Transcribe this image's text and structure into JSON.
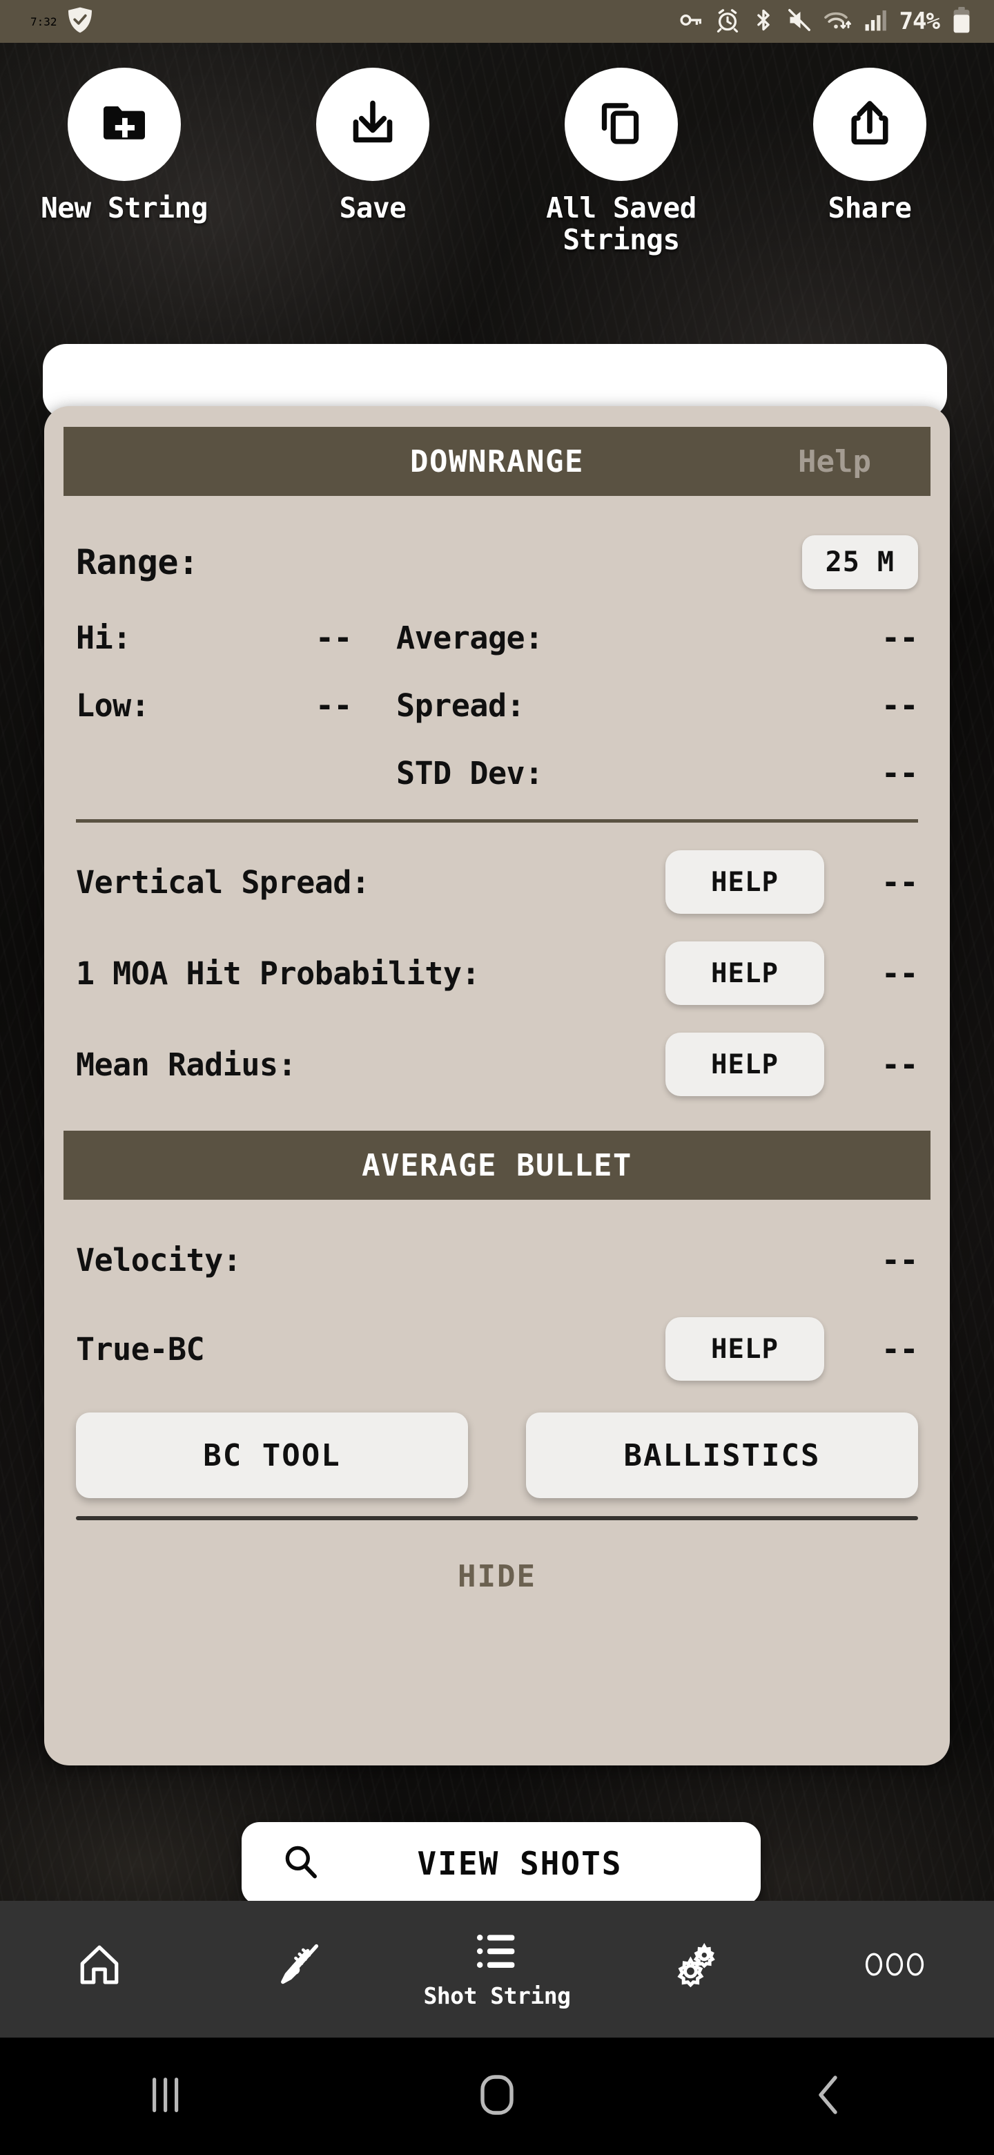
{
  "status_bar": {
    "time": "7:32",
    "shield_icon": "shield-check-icon",
    "icons": [
      "vpn-key-icon",
      "alarm-icon",
      "bluetooth-icon",
      "mute-icon",
      "wifi-icon",
      "cellular-signal-icon"
    ],
    "battery_percent": "74%",
    "background_color": "#5a5242"
  },
  "toolbar": {
    "items": [
      {
        "label": "New String",
        "icon": "folder-plus-icon"
      },
      {
        "label": "Save",
        "icon": "download-icon"
      },
      {
        "label": "All Saved Strings",
        "icon": "copy-icon"
      },
      {
        "label": "Share",
        "icon": "share-upload-icon"
      }
    ]
  },
  "card": {
    "downrange": {
      "title": "DOWNRANGE",
      "help_label": "Help"
    },
    "range": {
      "label": "Range:",
      "value_chip": "25 M"
    },
    "stats": [
      {
        "left_label": "Hi:",
        "left_value": "--",
        "right_label": "Average:",
        "right_value": "--"
      },
      {
        "left_label": "Low:",
        "left_value": "--",
        "right_label": "Spread:",
        "right_value": "--"
      },
      {
        "left_label": "",
        "left_value": "",
        "right_label": "STD Dev:",
        "right_value": "--"
      }
    ],
    "help_rows": [
      {
        "label": "Vertical Spread:",
        "button": "HELP",
        "value": "--"
      },
      {
        "label": "1 MOA Hit Probability:",
        "button": "HELP",
        "value": "--"
      },
      {
        "label": "Mean Radius:",
        "button": "HELP",
        "value": "--"
      }
    ],
    "average_bullet": {
      "title": "AVERAGE BULLET",
      "velocity_label": "Velocity:",
      "velocity_value": "--",
      "truebc_label": "True-BC",
      "truebc_button": "HELP",
      "truebc_value": "--"
    },
    "buttons": {
      "bc_tool": "BC TOOL",
      "ballistics": "BALLISTICS"
    },
    "hide_label": "HIDE"
  },
  "view_shots": {
    "label": "VIEW SHOTS",
    "icon": "search-icon"
  },
  "bottom_nav": {
    "items": [
      {
        "label": "",
        "icon": "home-icon",
        "active": false
      },
      {
        "label": "",
        "icon": "rifle-icon",
        "active": false
      },
      {
        "label": "Shot String",
        "icon": "list-icon",
        "active": true
      },
      {
        "label": "",
        "icon": "gears-icon",
        "active": false
      },
      {
        "label": "",
        "icon": "more-dots-icon",
        "active": false
      }
    ]
  },
  "system_nav": {
    "recents": "recents-icon",
    "home": "home-square-icon",
    "back": "back-chevron-icon"
  },
  "colors": {
    "header_brown": "#5a5242",
    "card_bg": "#d4cbc2",
    "pill_bg": "#f0efed",
    "nav_bg": "#333333"
  }
}
